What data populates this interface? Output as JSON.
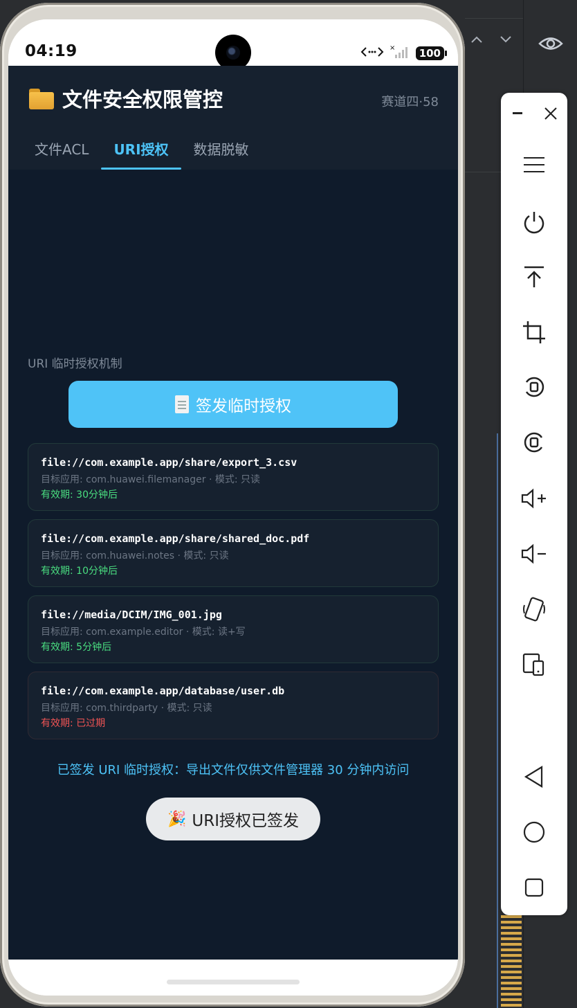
{
  "status_bar": {
    "time": "04:19",
    "battery": "100"
  },
  "app": {
    "title": "文件安全权限管控",
    "track": "赛道四·58",
    "tabs": [
      {
        "label": "文件ACL",
        "active": false
      },
      {
        "label": "URI授权",
        "active": true
      },
      {
        "label": "数据脱敏",
        "active": false
      }
    ],
    "section_label": "URI 临时授权机制",
    "issue_button_label": "签发临时授权",
    "grants": [
      {
        "path": "file://com.example.app/share/export_3.csv",
        "meta": "目标应用: com.huawei.filemanager · 模式: 只读",
        "expiry": "有效期: 30分钟后",
        "expired": false
      },
      {
        "path": "file://com.example.app/share/shared_doc.pdf",
        "meta": "目标应用: com.huawei.notes · 模式: 只读",
        "expiry": "有效期: 10分钟后",
        "expired": false
      },
      {
        "path": "file://media/DCIM/IMG_001.jpg",
        "meta": "目标应用: com.example.editor · 模式: 读+写",
        "expiry": "有效期: 5分钟后",
        "expired": false
      },
      {
        "path": "file://com.example.app/database/user.db",
        "meta": "目标应用: com.thirdparty · 模式: 只读",
        "expiry": "有效期: 已过期",
        "expired": true
      }
    ],
    "notice": "已签发 URI 临时授权：导出文件仅供文件管理器 30 分钟内访问",
    "toast": "URI授权已签发"
  },
  "colors": {
    "accent": "#4fc3f7",
    "valid": "#4ade80",
    "expired": "#f05454",
    "app_bg": "#0f1b2b"
  },
  "side_panel": {
    "buttons": [
      "minimize-icon",
      "close-icon",
      "menu-icon",
      "power-icon",
      "upload-icon",
      "crop-icon",
      "rotate-left-icon",
      "rotate-right-icon",
      "volume-up-icon",
      "volume-down-icon",
      "shake-icon",
      "fold-icon",
      "back-icon",
      "home-icon",
      "overview-icon"
    ]
  }
}
